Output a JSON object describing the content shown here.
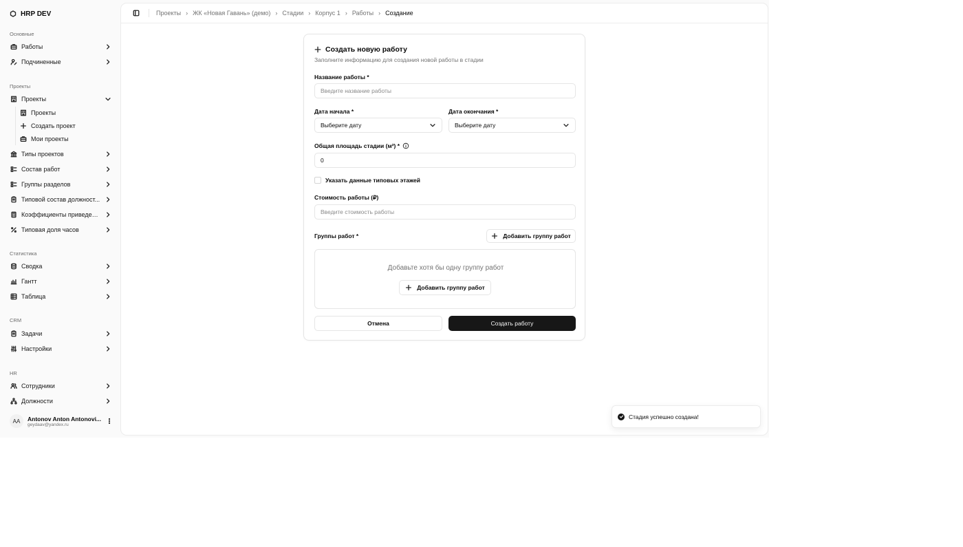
{
  "brand": {
    "name": "HRP DEV"
  },
  "sidebar": {
    "groups": {
      "main": "Основные",
      "projects": "Проекты",
      "stats": "Статистика",
      "crm": "CRM",
      "hr": "HR"
    },
    "items": {
      "works": "Работы",
      "subordinates": "Подчиненные",
      "projects": "Проекты",
      "projects_sub": "Проекты",
      "create_project": "Создать проект",
      "my_projects": "Мои проекты",
      "project_types": "Типы проектов",
      "work_composition": "Состав работ",
      "section_groups": "Группы разделов",
      "typical_positions": "Типовой состав должност...",
      "coefficients": "Коэффициенты приведени...",
      "hours_share": "Типовая доля часов",
      "summary": "Сводка",
      "gantt": "Гантт",
      "table": "Таблица",
      "tasks": "Задачи",
      "settings": "Настройки",
      "employees": "Сотрудники",
      "positions": "Должности"
    },
    "user": {
      "initials": "AA",
      "name": "Antonov Anton Antonovi...",
      "email": "geydaav@yandex.ru"
    }
  },
  "breadcrumbs": [
    "Проекты",
    "ЖК «Новая Гавань» (демо)",
    "Стадии",
    "Корпус 1",
    "Работы",
    "Создание"
  ],
  "form": {
    "title": "Создать новую работу",
    "description": "Заполните информацию для создания новой работы в стадии",
    "name_label": "Название работы *",
    "name_placeholder": "Введите название работы",
    "start_label": "Дата начала *",
    "start_value": "Выберите дату",
    "end_label": "Дата окончания *",
    "end_value": "Выберите дату",
    "area_label": "Общая площадь стадии (м²) *",
    "area_value": "0",
    "typical_floors_label": "Указать данные типовых этажей",
    "cost_label": "Стоимость работы (₽)",
    "cost_placeholder": "Введите стоимость работы",
    "groups_label": "Группы работ *",
    "add_group_button": "Добавить группу работ",
    "empty_text": "Добавьте хотя бы одну группу работ",
    "empty_add_button": "Добавить группу работ",
    "cancel_button": "Отмена",
    "submit_button": "Создать работу"
  },
  "toast": {
    "message": "Стадия успешно создана!"
  }
}
